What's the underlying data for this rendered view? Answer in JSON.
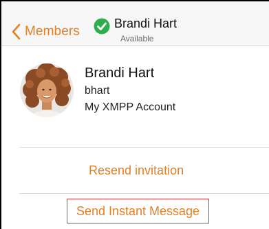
{
  "navbar": {
    "back_label": "Members",
    "title": "Brandi Hart",
    "status": "Available",
    "presence_color": "#2eae4b",
    "accent_color": "#e67e22"
  },
  "contact": {
    "name": "Brandi Hart",
    "username": "bhart",
    "account": "My XMPP Account"
  },
  "actions": {
    "resend": "Resend invitation",
    "send_message": "Send Instant Message"
  },
  "highlight_color": "#d9363e"
}
